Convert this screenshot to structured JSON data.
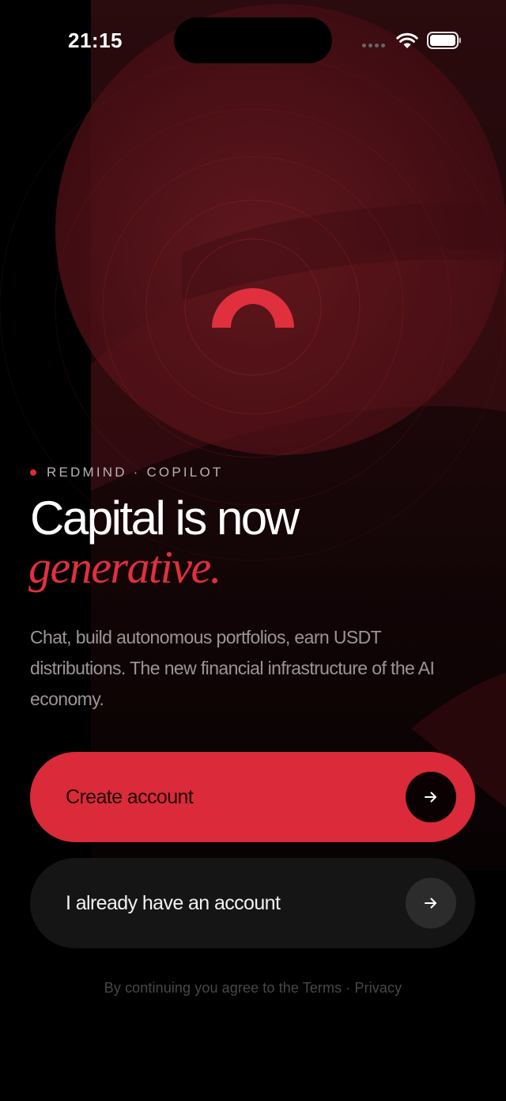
{
  "status": {
    "time": "21:15"
  },
  "brand": {
    "logo_icon": "arch-logo-icon",
    "eyebrow": "REDMIND · COPILOT"
  },
  "hero": {
    "headline": "Capital is now",
    "headline_accent": "generative.",
    "description": "Chat, build autonomous portfolios, earn USDT distributions. The new financial infrastructure of the AI economy."
  },
  "actions": {
    "create_account": "Create account",
    "login": "I already have an account",
    "arrow_icon": "arrow-right-icon"
  },
  "footer": {
    "legal": "By continuing you agree to the Terms · Privacy"
  },
  "colors": {
    "accent": "#db2a39",
    "background": "#000000",
    "panel": "#2a0b0e"
  }
}
